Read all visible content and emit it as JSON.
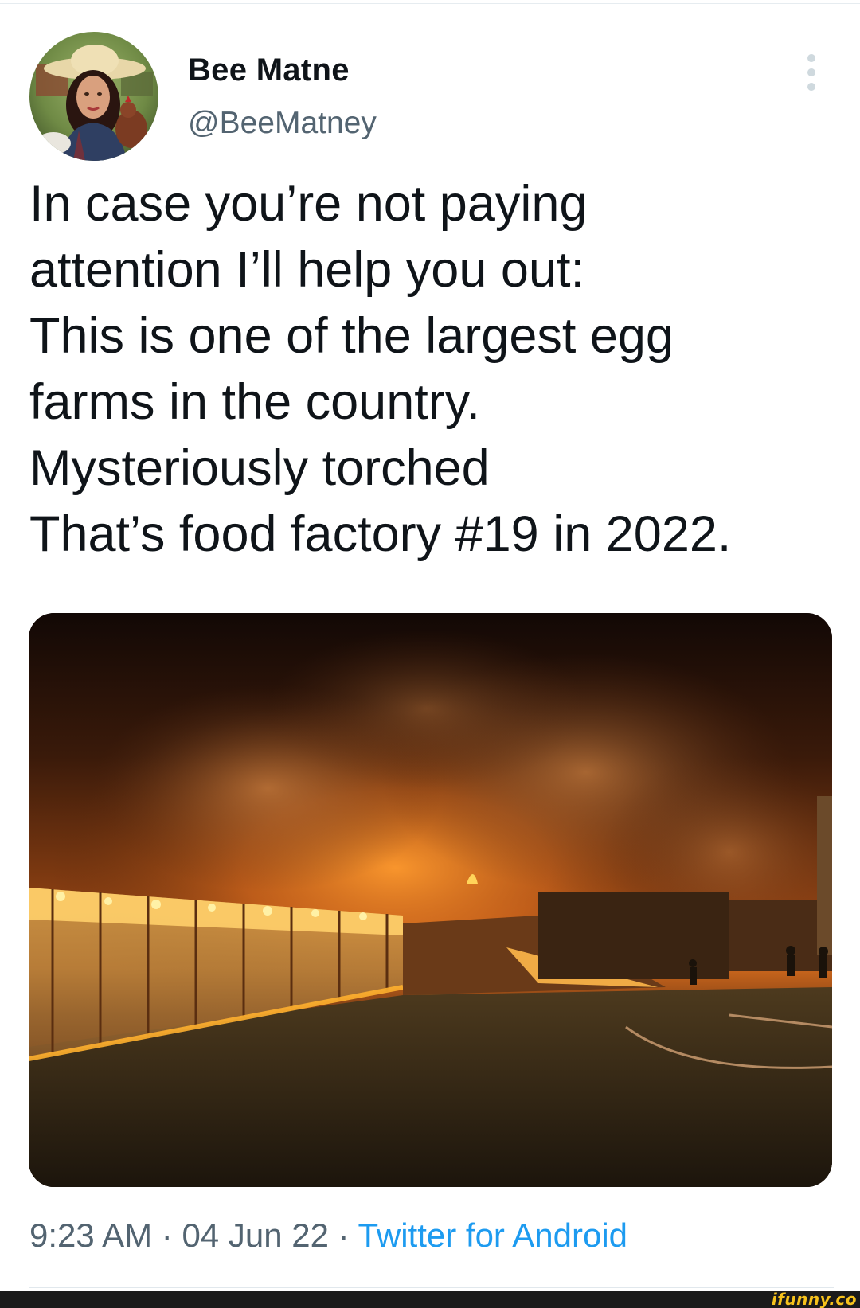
{
  "tweet": {
    "display_name": "Bee Matne",
    "handle": "@BeeMatney",
    "text_lines": [
      "In case you’re not paying",
      "attention I’ll help you out:",
      "This is one of the largest egg",
      "farms in the country.",
      "Mysteriously torched",
      "That’s food factory #19 in 2022."
    ],
    "time": "9:23 AM",
    "date": "04 Jun 22",
    "separator": "·",
    "source": "Twitter for Android"
  },
  "icons": {
    "more": "more-vertical-icon",
    "avatar": "profile-avatar"
  },
  "watermark": "ifunny.co",
  "colors": {
    "text": "#0f1419",
    "secondary": "#536471",
    "link": "#1d9bf0",
    "watermark": "#f6c21c"
  }
}
